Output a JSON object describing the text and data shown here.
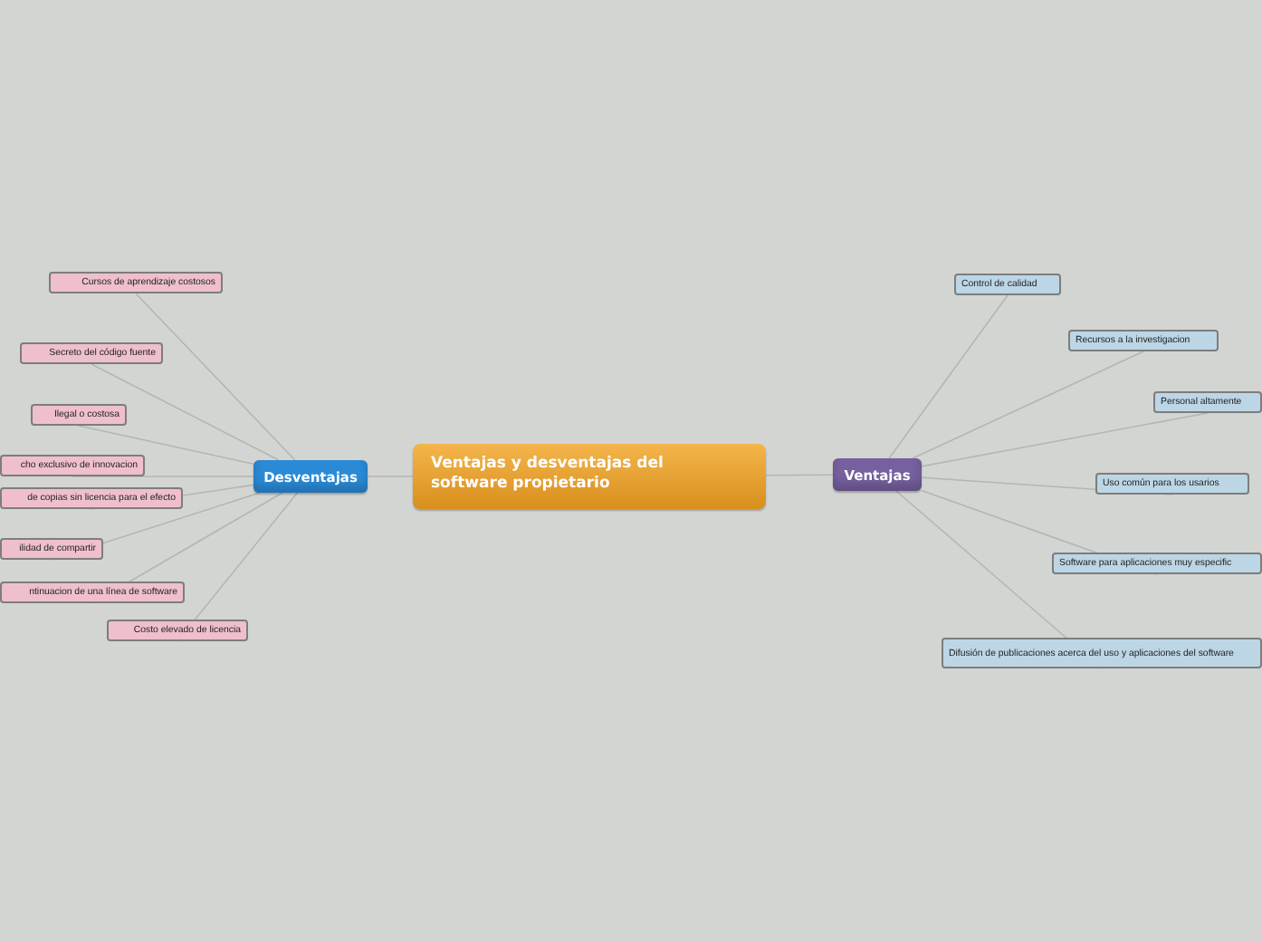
{
  "central": {
    "title": "Ventajas y desventajas del software propietario"
  },
  "branches": [
    {
      "label": "Desventajas",
      "color": "#2a8ad6",
      "children": [
        {
          "label": "Cursos de aprendizaje costosos"
        },
        {
          "label": "Secreto del código fuente"
        },
        {
          "label": "Ilegal o costosa"
        },
        {
          "label": "cho exclusivo de innovacion"
        },
        {
          "label": "de copias sin licencia para el efecto"
        },
        {
          "label": "ilidad de compartir"
        },
        {
          "label": "ntinuacion de una línea de software"
        },
        {
          "label": "Costo elevado de licencia"
        }
      ]
    },
    {
      "label": "Ventajas",
      "color": "#76609f",
      "children": [
        {
          "label": "Control de calidad"
        },
        {
          "label": "Recursos a la investigacion"
        },
        {
          "label": "Personal altamente"
        },
        {
          "label": "Uso común para los usarios"
        },
        {
          "label": "Software para aplicaciones muy especific"
        },
        {
          "label": "Difusión de publicaciones acerca del uso y aplicaciones del software"
        }
      ]
    }
  ]
}
